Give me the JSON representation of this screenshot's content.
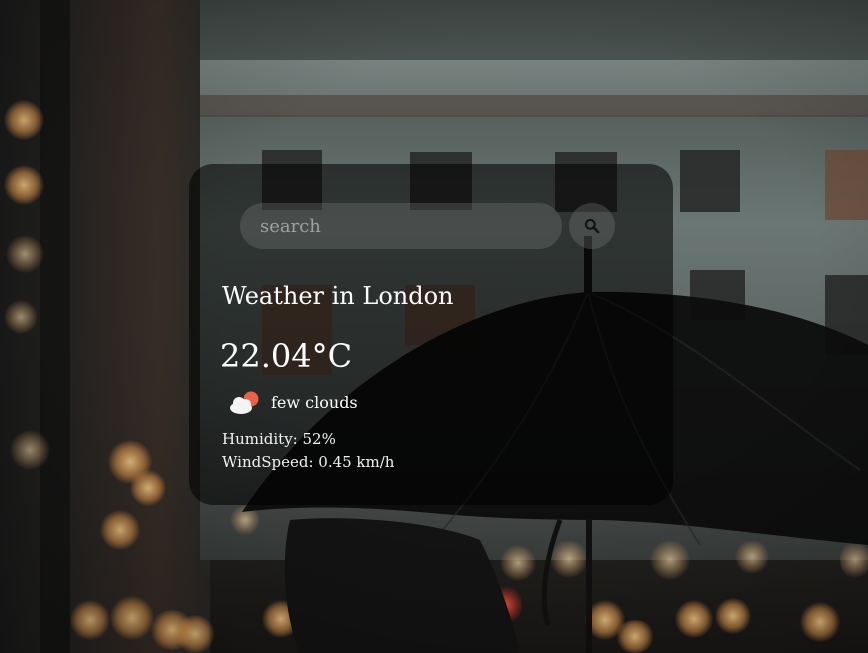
{
  "search": {
    "placeholder": "search",
    "value": "",
    "button_icon": "search-icon"
  },
  "weather": {
    "title": "Weather in London",
    "temperature": "22.04°C",
    "description": "few clouds",
    "condition_icon": "few-clouds-icon",
    "humidity_label": "Humidity: 52%",
    "wind_label": "WindSpeed: 0.45 km/h"
  },
  "colors": {
    "card_background": "#000000",
    "text": "#ffffff",
    "input_background": "#7d7d7d",
    "sun": "#e8624a"
  }
}
